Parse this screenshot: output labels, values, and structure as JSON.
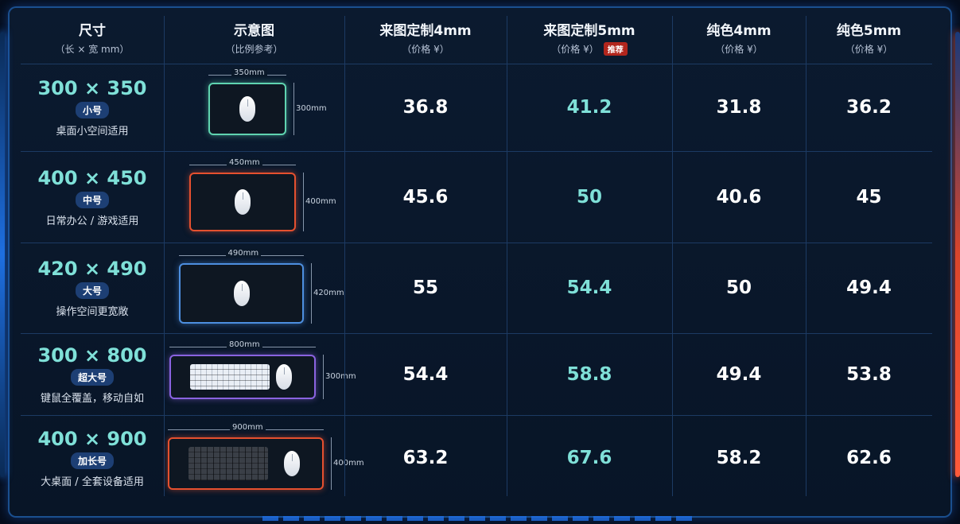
{
  "header": {
    "col1": {
      "title": "尺寸",
      "sub": "（长 × 宽 mm）"
    },
    "col2": {
      "title": "示意图",
      "sub": "（比例参考）"
    },
    "col3": {
      "title": "来图定制4mm",
      "sub": "（价格 ¥）"
    },
    "col4": {
      "title": "来图定制5mm",
      "sub": "（价格 ¥）",
      "badge": "推荐"
    },
    "col5": {
      "title": "纯色4mm",
      "sub": "（价格 ¥）"
    },
    "col6": {
      "title": "纯色5mm",
      "sub": "（价格 ¥）"
    }
  },
  "rows": [
    {
      "size": "300 × 350",
      "badge": "小号",
      "desc": "桌面小空间适用",
      "w_label": "350mm",
      "h_label": "300mm",
      "p1": "36.8",
      "p2": "41.2",
      "p3": "31.8",
      "p4": "36.2",
      "border": "#5fd4b0"
    },
    {
      "size": "400 × 450",
      "badge": "中号",
      "desc": "日常办公 / 游戏适用",
      "w_label": "450mm",
      "h_label": "400mm",
      "p1": "45.6",
      "p2": "50",
      "p3": "40.6",
      "p4": "45",
      "border": "#e5502f"
    },
    {
      "size": "420 × 490",
      "badge": "大号",
      "desc": "操作空间更宽敞",
      "w_label": "490mm",
      "h_label": "420mm",
      "p1": "55",
      "p2": "54.4",
      "p3": "50",
      "p4": "49.4",
      "border": "#4d8fe0"
    },
    {
      "size": "300 × 800",
      "badge": "超大号",
      "desc": "键鼠全覆盖，移动自如",
      "w_label": "800mm",
      "h_label": "300mm",
      "p1": "54.4",
      "p2": "58.8",
      "p3": "49.4",
      "p4": "53.8",
      "border": "#8a63e0"
    },
    {
      "size": "400 × 900",
      "badge": "加长号",
      "desc": "大桌面 / 全套设备适用",
      "w_label": "900mm",
      "h_label": "400mm",
      "p1": "63.2",
      "p2": "67.6",
      "p3": "58.2",
      "p4": "62.6",
      "border": "#e5502f"
    }
  ],
  "colors": {
    "accent": "#7fe0d8",
    "badge_bg": "#1d3f74",
    "recommend": "#b2261d"
  }
}
